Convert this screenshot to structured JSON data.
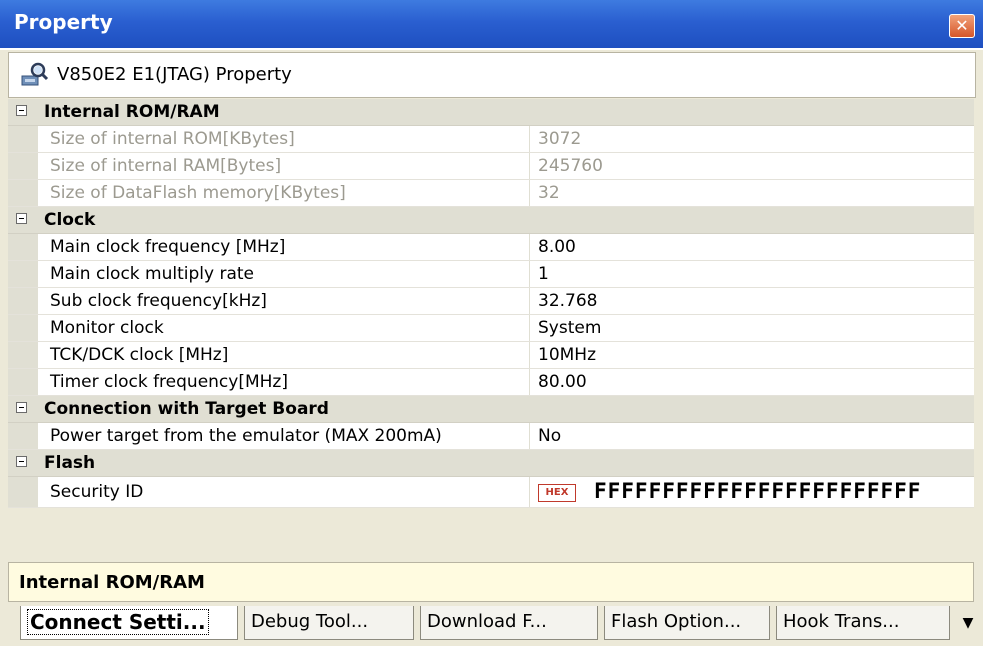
{
  "window": {
    "title": "Property"
  },
  "header": {
    "text": "V850E2 E1(JTAG) Property"
  },
  "categories": [
    {
      "title": "Internal ROM/RAM",
      "rows": [
        {
          "name": "Size of internal ROM[KBytes]",
          "value": "3072",
          "disabled": true
        },
        {
          "name": "Size of internal RAM[Bytes]",
          "value": "245760",
          "disabled": true
        },
        {
          "name": "Size of DataFlash memory[KBytes]",
          "value": "32",
          "disabled": true
        }
      ]
    },
    {
      "title": "Clock",
      "rows": [
        {
          "name": "Main clock frequency [MHz]",
          "value": "8.00"
        },
        {
          "name": "Main clock multiply rate",
          "value": "1"
        },
        {
          "name": "Sub clock frequency[kHz]",
          "value": "32.768"
        },
        {
          "name": "Monitor clock",
          "value": "System"
        },
        {
          "name": "TCK/DCK clock [MHz]",
          "value": "10MHz"
        },
        {
          "name": "Timer clock frequency[MHz]",
          "value": "80.00"
        }
      ]
    },
    {
      "title": "Connection with Target Board",
      "rows": [
        {
          "name": "Power target from the emulator (MAX 200mA)",
          "value": "No"
        }
      ]
    },
    {
      "title": "Flash",
      "rows": [
        {
          "name": "Security ID",
          "value": "FFFFFFFFFFFFFFFFFFFFFFFF",
          "badge": "HEX"
        }
      ]
    }
  ],
  "description": "Internal ROM/RAM",
  "tabs": [
    {
      "label": "Connect Setti...",
      "active": true
    },
    {
      "label": "Debug Tool..."
    },
    {
      "label": "Download F..."
    },
    {
      "label": "Flash Option..."
    },
    {
      "label": "Hook Trans..."
    }
  ],
  "tab_overflow_glyph": "▼",
  "close_glyph": "✕"
}
